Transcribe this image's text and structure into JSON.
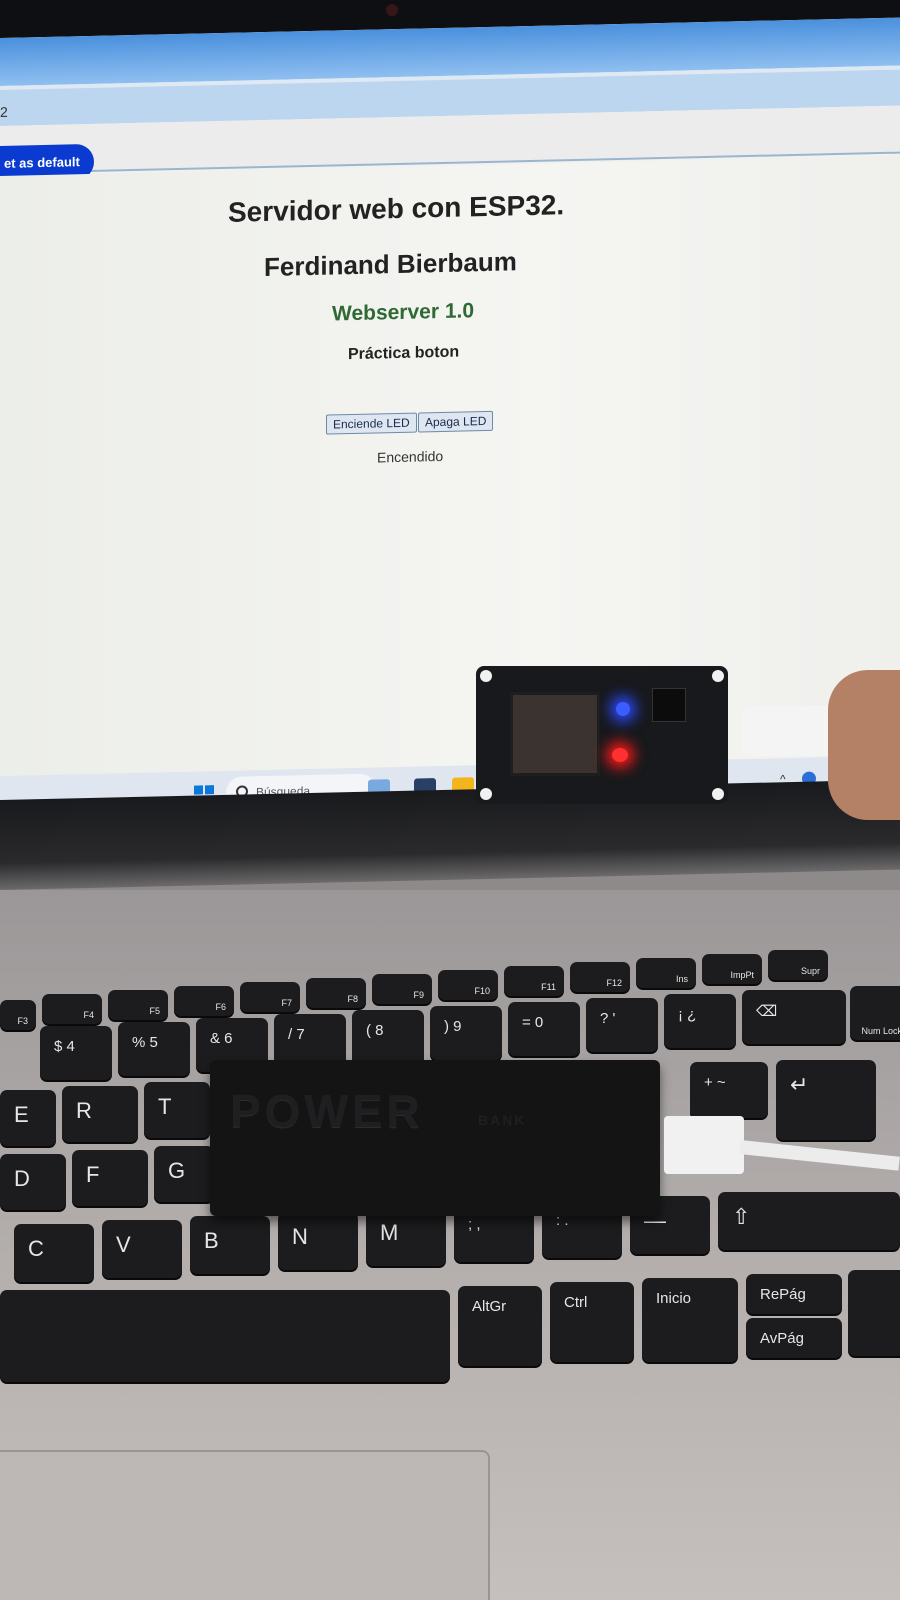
{
  "browser": {
    "address_fragment": "2",
    "set_default_label": "et as default"
  },
  "page": {
    "title": "Servidor web con ESP32.",
    "author": "Ferdinand Bierbaum",
    "subtitle": "Webserver 1.0",
    "heading": "Práctica boton",
    "button_on": "Enciende LED",
    "button_off": "Apaga LED",
    "status": "Encendido"
  },
  "taskbar": {
    "search_placeholder": "Búsqueda"
  },
  "keyboard": {
    "fkeys": [
      "F3",
      "F4",
      "F5",
      "F6",
      "F7",
      "F8",
      "F9",
      "F10",
      "F11",
      "F12",
      "Ins",
      "ImpPt",
      "Supr"
    ],
    "number_row": [
      "$ 4",
      "% 5",
      "& 6",
      "/ 7",
      "( 8",
      ") 9",
      "= 0",
      "? '",
      "¡ ¿"
    ],
    "numlock": "Num Lock",
    "row_q": [
      "E",
      "R",
      "T"
    ],
    "row_a": [
      "D",
      "F",
      "G"
    ],
    "row_z": [
      "C",
      "V",
      "B",
      "N",
      "M",
      "; ,",
      ": ."
    ],
    "bottom": [
      "AltGr",
      "Ctrl",
      "Inicio",
      "RePág",
      "AvPág"
    ],
    "plus_key": "+ ~",
    "star_key": "*"
  },
  "power_bank": {
    "brand": "POWER",
    "sub": "BANK"
  },
  "colors": {
    "set_default_button": "#0a3ad0",
    "subtitle": "#2f6a34",
    "led_blue": "#3b5cff",
    "led_red": "#ff3030"
  }
}
